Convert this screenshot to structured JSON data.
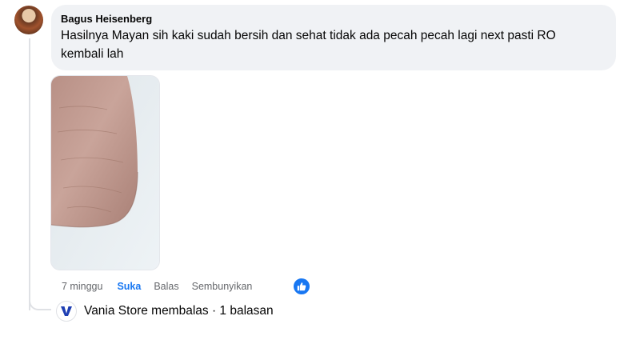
{
  "comment": {
    "author": "Bagus Heisenberg",
    "text": "Hasilnya Mayan sih kaki sudah bersih dan sehat tidak ada pecah pecah lagi next pasti RO kembali lah"
  },
  "actions": {
    "time": "7 minggu",
    "like": "Suka",
    "reply": "Balas",
    "hide": "Sembunyikan"
  },
  "reply_summary": {
    "text": "Vania Store membalas · 1 balasan"
  },
  "colors": {
    "accent": "#1877f2",
    "bubble": "#f0f2f5",
    "secondary_text": "#65676b"
  },
  "icons": {
    "like_reaction": "thumbs-up-icon",
    "store_logo": "vania-store-logo-icon"
  }
}
